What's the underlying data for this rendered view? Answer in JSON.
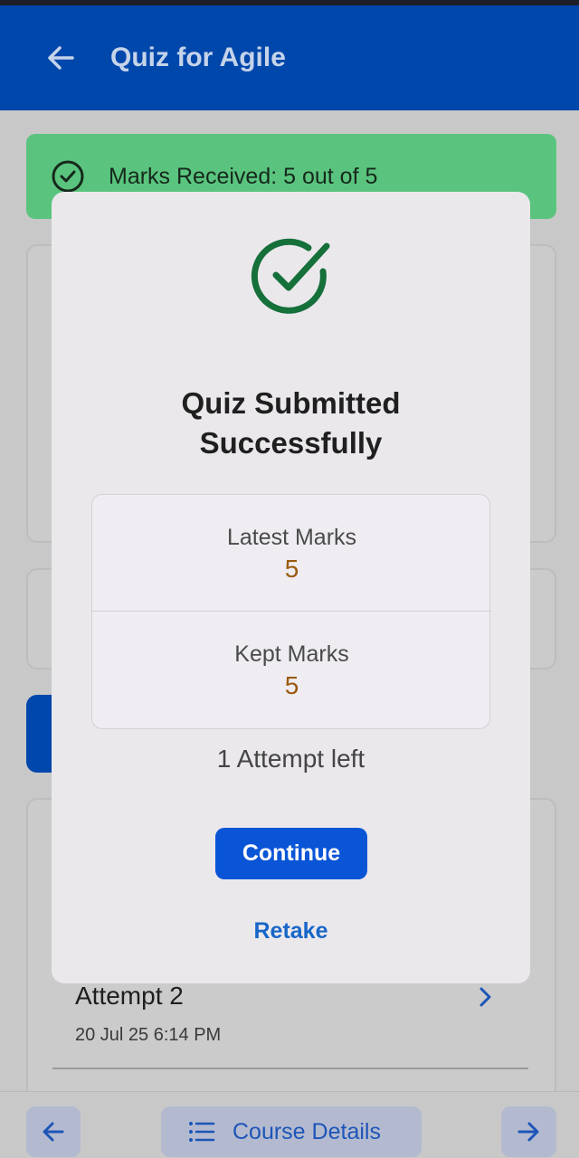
{
  "app_bar": {
    "title": "Quiz for Agile",
    "back_icon": "arrow-left-icon"
  },
  "banner": {
    "text": "Marks Received: 5 out of 5",
    "icon": "check-circle-icon",
    "color": "#5ac47e"
  },
  "dialog": {
    "heading_line1": "Quiz Submitted",
    "heading_line2": "Successfully",
    "latest_label": "Latest Marks",
    "latest_value": "5",
    "kept_label": "Kept Marks",
    "kept_value": "5",
    "attempts_left": "1 Attempt left",
    "continue_label": "Continue",
    "retake_label": "Retake",
    "success_color": "#15703a"
  },
  "attempt": {
    "title": "Attempt 2",
    "date": "20 Jul 25 6:14 PM"
  },
  "bottom_nav": {
    "course_label": "Course Details"
  },
  "colors": {
    "primary": "#0047ab",
    "button": "#0a55d6",
    "marks_value": "#9a5a10"
  }
}
